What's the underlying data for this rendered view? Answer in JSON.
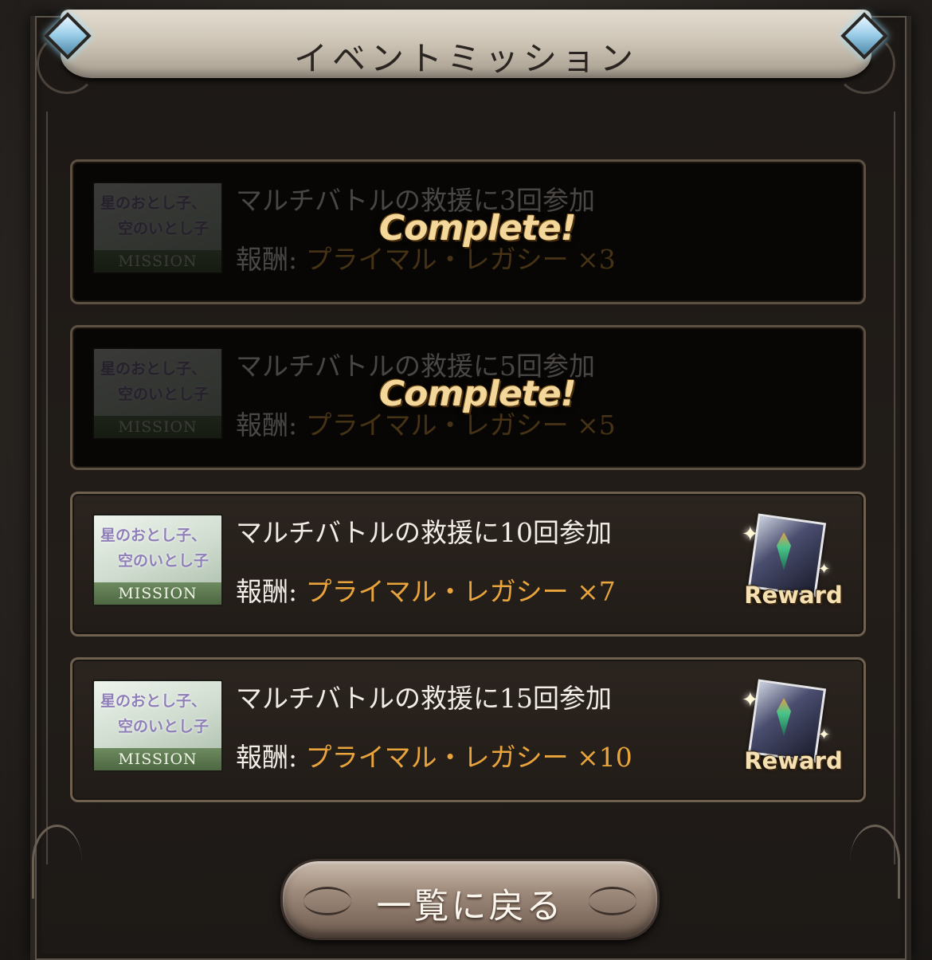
{
  "header": {
    "title": "イベントミッション"
  },
  "missions": [
    {
      "thumb_line1": "星のおとし子、",
      "thumb_line2": "空のいとし子",
      "thumb_band": "MISSION",
      "title": "マルチバトルの救援に3回参加",
      "reward_label": "報酬:",
      "reward_value": "プライマル・レガシー ×3",
      "status": "Complete!"
    },
    {
      "thumb_line1": "星のおとし子、",
      "thumb_line2": "空のいとし子",
      "thumb_band": "MISSION",
      "title": "マルチバトルの救援に5回参加",
      "reward_label": "報酬:",
      "reward_value": "プライマル・レガシー ×5",
      "status": "Complete!"
    },
    {
      "thumb_line1": "星のおとし子、",
      "thumb_line2": "空のいとし子",
      "thumb_band": "MISSION",
      "title": "マルチバトルの救援に10回参加",
      "reward_label": "報酬:",
      "reward_value": "プライマル・レガシー ×7",
      "reward_button": "Reward"
    },
    {
      "thumb_line1": "星のおとし子、",
      "thumb_line2": "空のいとし子",
      "thumb_band": "MISSION",
      "title": "マルチバトルの救援に15回参加",
      "reward_label": "報酬:",
      "reward_value": "プライマル・レガシー ×10",
      "reward_button": "Reward"
    }
  ],
  "footer": {
    "back_button": "一覧に戻る"
  },
  "colors": {
    "accent": "#e9a53b",
    "gem": "#9ed0ea",
    "frame": "#6e6150"
  }
}
